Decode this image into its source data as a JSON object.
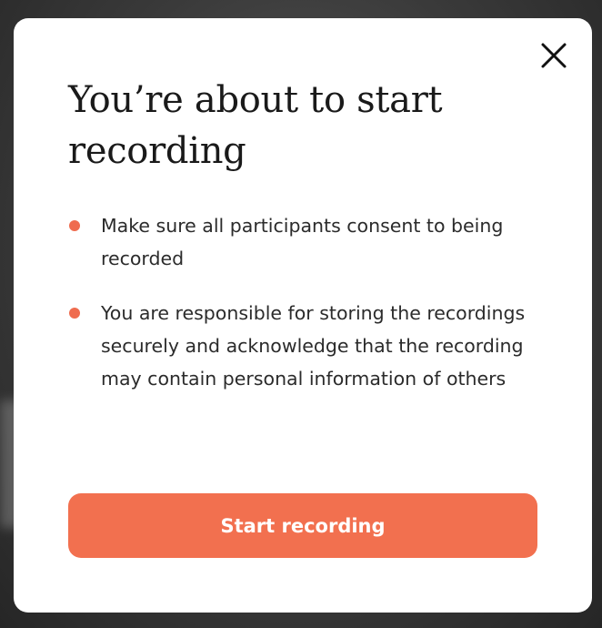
{
  "dialog": {
    "title": "You’re about to start recording",
    "close_icon": "close-icon",
    "bullets": [
      {
        "text": "Make sure all participants consent to being recorded"
      },
      {
        "text": "You are responsible for storing the recordings securely and acknowledge that the recording may contain personal information of others"
      }
    ],
    "primary_button_label": "Start recording"
  },
  "colors": {
    "accent": "#f2704f",
    "bullet": "#ef6c4f",
    "title_text": "#1a1a1a",
    "body_text": "#2b2b2b",
    "modal_bg": "#ffffff",
    "overlay_bg": "#3a3a3a"
  }
}
